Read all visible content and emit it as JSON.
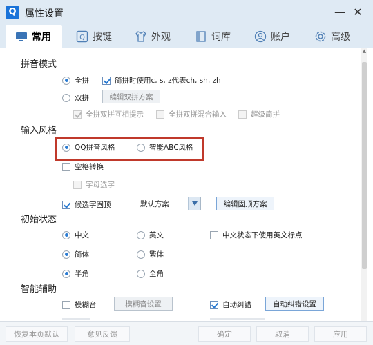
{
  "window": {
    "title": "属性设置",
    "logo": "Q"
  },
  "tabs": [
    {
      "label": "常用",
      "icon": "monitor-icon"
    },
    {
      "label": "按键",
      "icon": "key-icon"
    },
    {
      "label": "外观",
      "icon": "tshirt-icon"
    },
    {
      "label": "词库",
      "icon": "book-icon"
    },
    {
      "label": "账户",
      "icon": "user-icon"
    },
    {
      "label": "高级",
      "icon": "gear-icon"
    }
  ],
  "pinyin": {
    "title": "拼音模式",
    "full": "全拼",
    "jianpin_opt": "简拼时使用c, s, z代表ch, sh, zh",
    "double": "双拼",
    "edit_double_btn": "编辑双拼方案",
    "hint": "全拼双拼互相提示",
    "mixed": "全拼双拼混合输入",
    "super_jianpin": "超级简拼"
  },
  "style": {
    "title": "输入风格",
    "qq": "QQ拼音风格",
    "abc": "智能ABC风格",
    "space_convert": "空格转换",
    "letter_select": "字母选字",
    "fixed_top": "候选字固顶",
    "scheme_value": "默认方案",
    "edit_fixed_btn": "编辑固顶方案"
  },
  "initial": {
    "title": "初始状态",
    "chinese": "中文",
    "english": "英文",
    "cn_en_punct": "中文状态下使用英文标点",
    "simplified": "简体",
    "traditional": "繁体",
    "half": "半角",
    "full": "全角"
  },
  "assist": {
    "title": "智能辅助",
    "fuzzy": "模糊音",
    "fuzzy_btn": "模糊音设置",
    "autocorrect": "自动纠错",
    "autocorrect_btn": "自动纠错设置"
  },
  "footer": {
    "restore": "恢复本页默认",
    "feedback": "意见反馈",
    "ok": "确定",
    "cancel": "取消",
    "apply": "应用"
  },
  "colors": {
    "accent": "#2b7cd3",
    "logo": "#1a73d9",
    "highlight": "#c0392b"
  }
}
